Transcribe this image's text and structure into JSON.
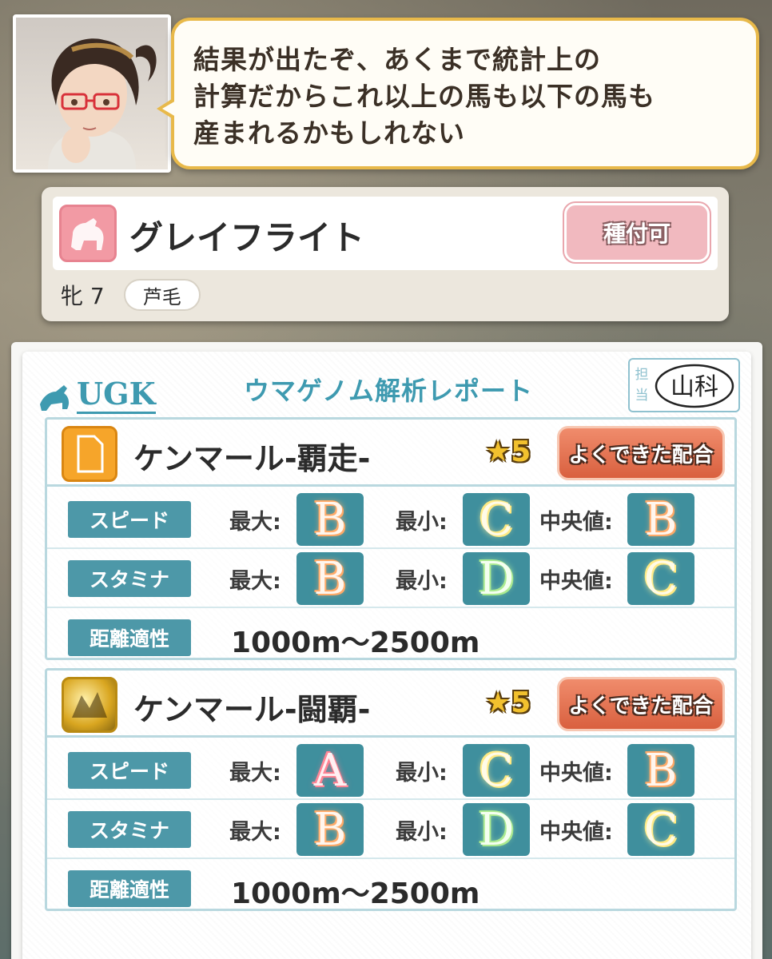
{
  "dialogue": {
    "lines": [
      "結果が出たぞ、あくまで統計上の",
      "計算だからこれ以上の馬も以下の馬も",
      "産まれるかもしれない"
    ]
  },
  "horse": {
    "name": "グレイフライト",
    "stud_button": "種付可",
    "sex_age": "牝 7",
    "coat": "芦毛"
  },
  "report": {
    "logo_text": "UGK",
    "title": "ウマゲノム解析レポート",
    "stamp_label": "担当",
    "stamp_signature": "山科",
    "factors": [
      {
        "name": "ケンマール-覇走-",
        "stars": "★5",
        "badge": "よくできた配合",
        "speed_label": "スピード",
        "stamina_label": "スタミナ",
        "distance_label": "距離適性",
        "max_label": "最大:",
        "min_label": "最小:",
        "median_label": "中央値:",
        "speed": {
          "max": "B",
          "min": "C",
          "median": "B"
        },
        "stamina": {
          "max": "B",
          "min": "D",
          "median": "C"
        },
        "distance": "1000m〜2500m"
      },
      {
        "name": "ケンマール-闘覇-",
        "stars": "★5",
        "badge": "よくできた配合",
        "speed_label": "スピード",
        "stamina_label": "スタミナ",
        "distance_label": "距離適性",
        "max_label": "最大:",
        "min_label": "最小:",
        "median_label": "中央値:",
        "speed": {
          "max": "A",
          "min": "C",
          "median": "B"
        },
        "stamina": {
          "max": "B",
          "min": "D",
          "median": "C"
        },
        "distance": "1000m〜2500m"
      }
    ]
  },
  "colors": {
    "accent_teal": "#4d98a8",
    "bubble_border": "#e8b94a",
    "badge_orange": "#d9603f",
    "stud_pink": "#f1b9bf"
  }
}
